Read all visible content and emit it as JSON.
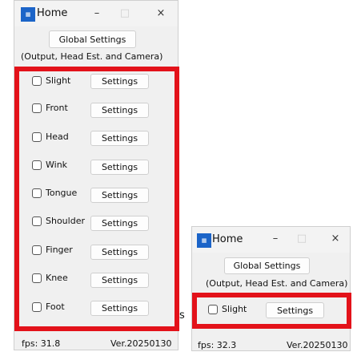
{
  "big_window": {
    "title": "Home",
    "icon": "app-icon",
    "minimize_label": "–",
    "maximize_label": "□",
    "close_label": "×",
    "global_settings_label": "Global Settings",
    "subtitle": "(Output, Head Est. and Camera)",
    "rows": [
      {
        "label": "Slight",
        "button": "Settings"
      },
      {
        "label": "Front",
        "button": "Settings"
      },
      {
        "label": "Head",
        "button": "Settings"
      },
      {
        "label": "Wink",
        "button": "Settings"
      },
      {
        "label": "Tongue",
        "button": "Settings"
      },
      {
        "label": "Shoulder",
        "button": "Settings"
      },
      {
        "label": "Finger",
        "button": "Settings"
      },
      {
        "label": "Knee",
        "button": "Settings"
      },
      {
        "label": "Foot",
        "button": "Settings"
      }
    ],
    "fps": "fps: 31.8",
    "version": "Ver.20250130"
  },
  "small_window": {
    "title": "Home",
    "icon": "app-icon",
    "minimize_label": "–",
    "maximize_label": "□",
    "close_label": "×",
    "global_settings_label": "Global Settings",
    "subtitle": "(Output, Head Est. and Camera)",
    "rows": [
      {
        "label": "Slight",
        "button": "Settings"
      }
    ],
    "fps": "fps: 32.3",
    "version": "Ver.20250130"
  },
  "stray_text": "s",
  "highlight_color": "#e3121a"
}
